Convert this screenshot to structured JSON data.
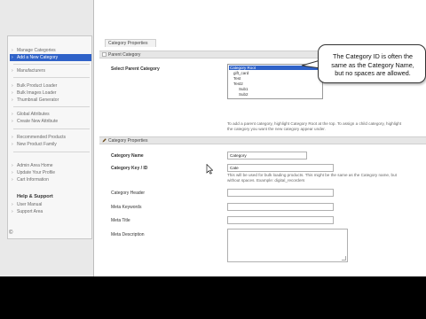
{
  "sidebar": {
    "groups": [
      {
        "items": [
          {
            "label": "Manage Categories",
            "active": false
          },
          {
            "label": "Add a New Category",
            "active": true
          }
        ]
      },
      {
        "items": [
          {
            "label": "Manufacturers",
            "active": false
          }
        ]
      },
      {
        "items": [
          {
            "label": "Bulk Product Loader",
            "active": false
          },
          {
            "label": "Bulk Images Loader",
            "active": false
          },
          {
            "label": "Thumbnail Generator",
            "active": false
          }
        ]
      },
      {
        "items": [
          {
            "label": "Global Attributes",
            "active": false
          },
          {
            "label": "Create New Attribute",
            "active": false
          }
        ]
      },
      {
        "items": [
          {
            "label": "Recommended Products",
            "active": false
          },
          {
            "label": "New Product Family",
            "active": false
          }
        ]
      },
      {
        "items": [
          {
            "label": "Admin Area Home",
            "active": false
          },
          {
            "label": "Update Your Profile",
            "active": false
          },
          {
            "label": "Cart Information",
            "active": false
          }
        ]
      }
    ],
    "help_heading": "Help & Support",
    "help_items": [
      {
        "label": "User Manual"
      },
      {
        "label": "Support Area"
      }
    ],
    "copyright_symbol": "©"
  },
  "main": {
    "tab_label": "Category Properties",
    "parent_section": {
      "header": "Parent Category",
      "select_label": "Select Parent Category",
      "tree": [
        {
          "label": "Category Root",
          "selected": true
        },
        {
          "label": "gift_card",
          "selected": false
        },
        {
          "label": "Test",
          "selected": false
        },
        {
          "label": "Test2",
          "selected": false
        },
        {
          "label": "Sub1",
          "selected": false
        },
        {
          "label": "Sub2",
          "selected": false
        }
      ],
      "help_line1": "To add a parent category, highlight Category Root at the top. To assign a child category, highlight",
      "help_line2": "the category you want the new category appear under."
    },
    "properties_section": {
      "header": "Category Properties",
      "name_label": "Category Name",
      "name_value": "Category",
      "key_label": "Category Key / ID",
      "key_value": "Cate",
      "key_help_line1": "This will be used for bulk loading products. This might be the same as the Category name, but",
      "key_help_line2": "without spaces. Example: digital_recorders",
      "header_label": "Category Header",
      "meta_keywords_label": "Meta Keywords",
      "meta_title_label": "Meta Title",
      "meta_description_label": "Meta Description"
    }
  },
  "callout": {
    "line1": "The Category ID is often the",
    "line2": "same as the Category Name,",
    "line3": "but no spaces are allowed."
  },
  "colors": {
    "accent": "#2f62c8",
    "sidebar_bg": "#e9e9e9",
    "section_header_bg": "#e6e6e6"
  }
}
